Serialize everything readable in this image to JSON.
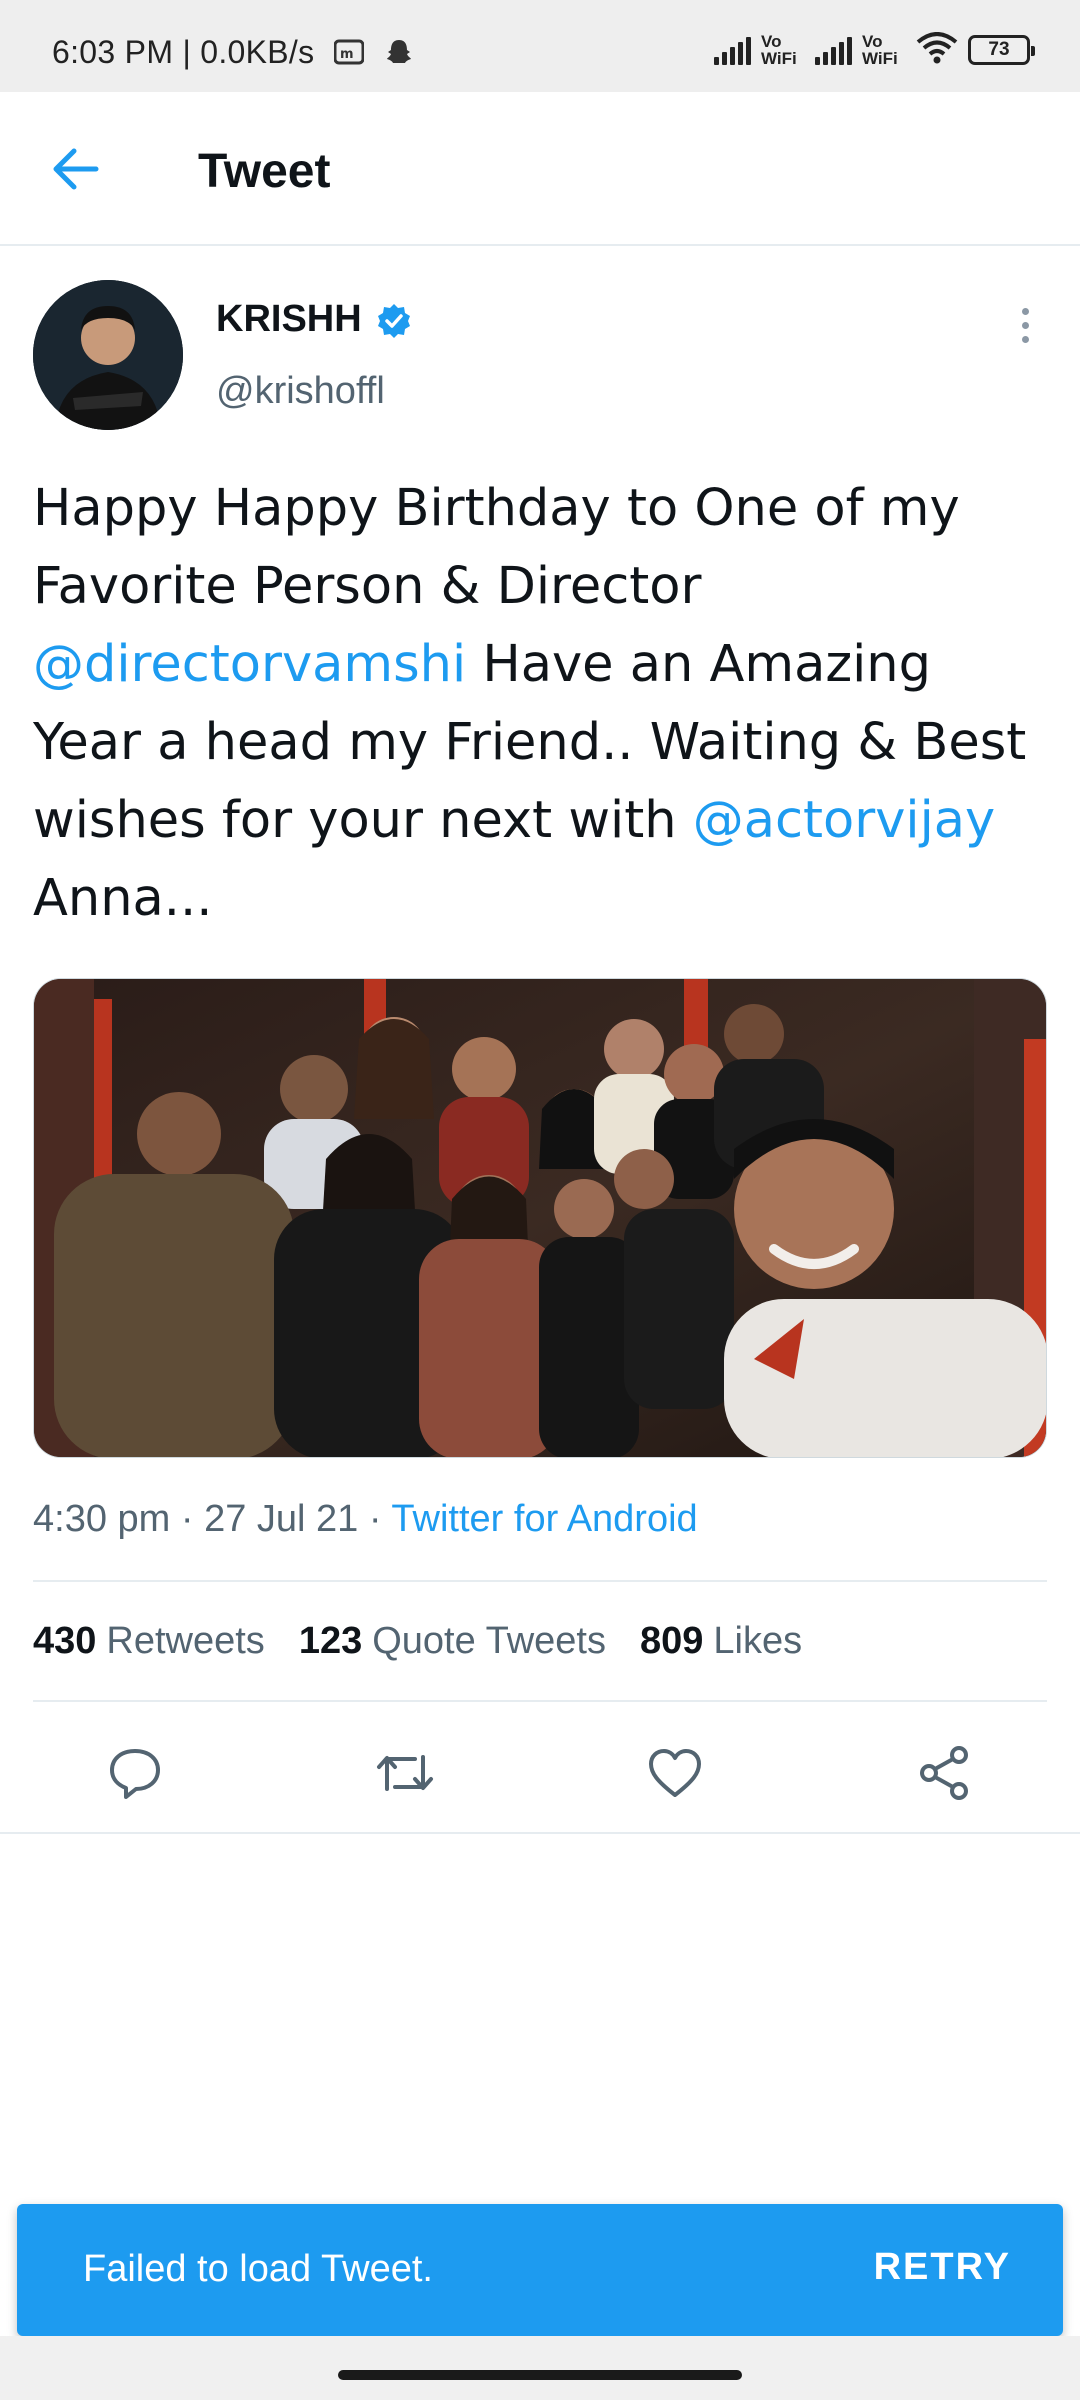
{
  "status_bar": {
    "time": "6:03 PM | 0.0KB/s",
    "vowifi_1": "Vo WiFi",
    "vowifi_2": "Vo WiFi",
    "battery": "73"
  },
  "header": {
    "title": "Tweet"
  },
  "tweet": {
    "user_name": "KRISHH",
    "user_handle": "@krishoffl",
    "text_parts": [
      "Happy Happy Birthday to One of my Favorite Person & Director ",
      "@directorvamshi",
      " Have an Amazing Year a head my Friend.. Waiting & Best wishes for your next with ",
      "@actorvijay",
      " Anna..."
    ],
    "time": "4:30 pm",
    "date": "27 Jul 21",
    "source": "Twitter for Android",
    "retweets_count": "430",
    "retweets_label": "Retweets",
    "quotes_count": "123",
    "quotes_label": "Quote Tweets",
    "likes_count": "809",
    "likes_label": "Likes"
  },
  "actions": [
    "reply-icon",
    "retweet-icon",
    "like-icon",
    "share-icon"
  ],
  "snackbar": {
    "message": "Failed to load Tweet.",
    "action": "RETRY"
  },
  "colors": {
    "accent": "#1d9bf0",
    "text": "#0f1419",
    "muted": "#536471"
  }
}
